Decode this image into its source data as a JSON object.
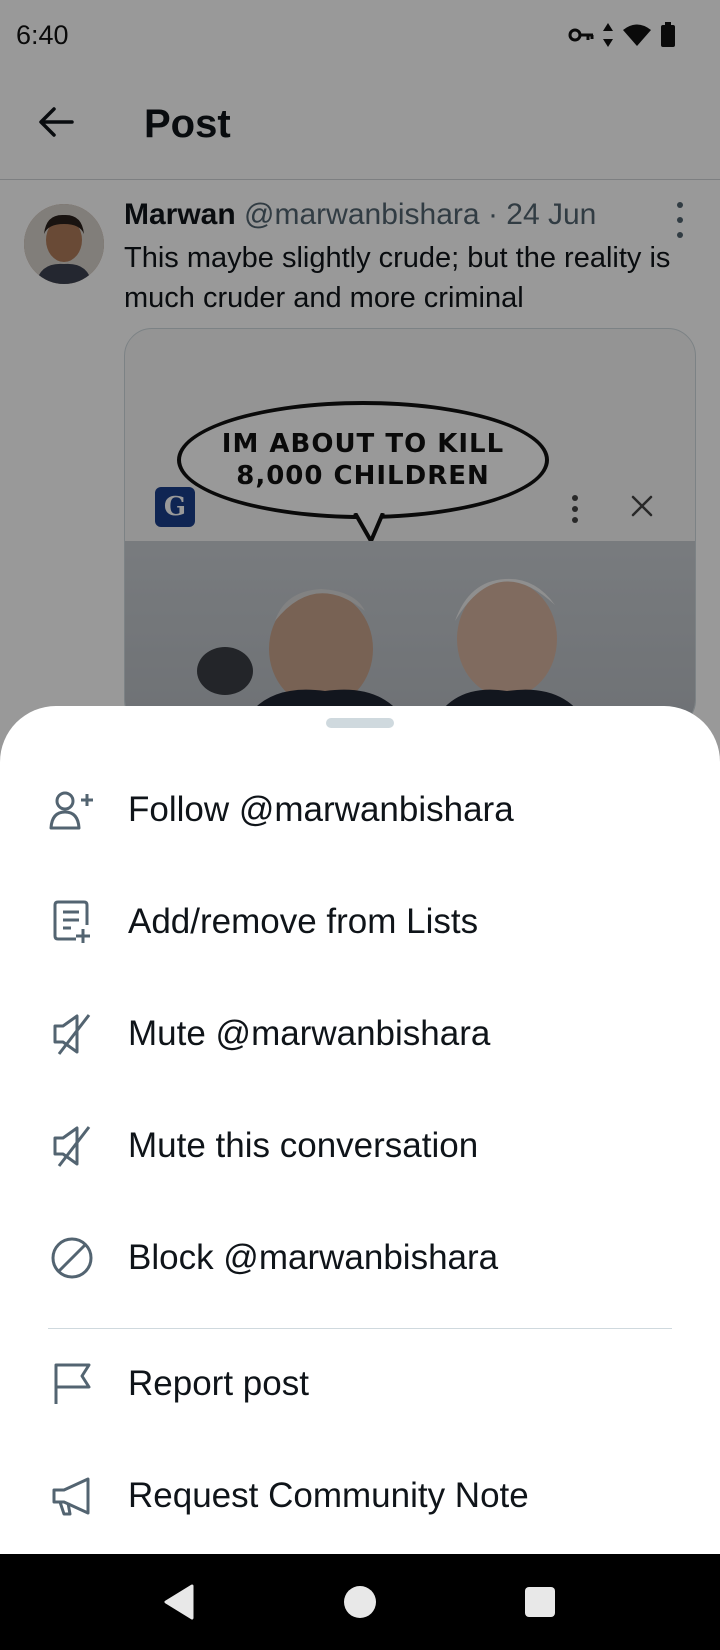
{
  "status_bar": {
    "time": "6:40",
    "icons": [
      "vpn-key-icon",
      "data-arrows-icon",
      "wifi-icon",
      "battery-icon"
    ]
  },
  "top_bar": {
    "title": "Post"
  },
  "tweet": {
    "author_name": "Marwan",
    "handle": "@marwanbishara",
    "separator": "·",
    "date": "24 Jun",
    "text": "This maybe slightly crude; but the reality is much cruder and more criminal",
    "media": {
      "bubble_line1": "IM ABOUT TO KILL",
      "bubble_line2": "8,000 CHILDREN",
      "source_logo_letter": "G"
    }
  },
  "sheet": {
    "items": [
      {
        "label": "Follow @marwanbishara",
        "icon": "follow-user-icon"
      },
      {
        "label": "Add/remove from Lists",
        "icon": "list-add-icon"
      },
      {
        "label": "Mute @marwanbishara",
        "icon": "mute-icon"
      },
      {
        "label": "Mute this conversation",
        "icon": "mute-icon"
      },
      {
        "label": "Block @marwanbishara",
        "icon": "block-icon"
      },
      {
        "label": "Report post",
        "icon": "flag-icon"
      },
      {
        "label": "Request Community Note",
        "icon": "megaphone-icon"
      }
    ]
  },
  "colors": {
    "text_primary": "#0f1419",
    "text_secondary": "#536471",
    "icon_color": "#536471",
    "scrim": "rgba(0,0,0,0.40)",
    "divider": "#cfd9de",
    "nav_bar": "#000000"
  }
}
